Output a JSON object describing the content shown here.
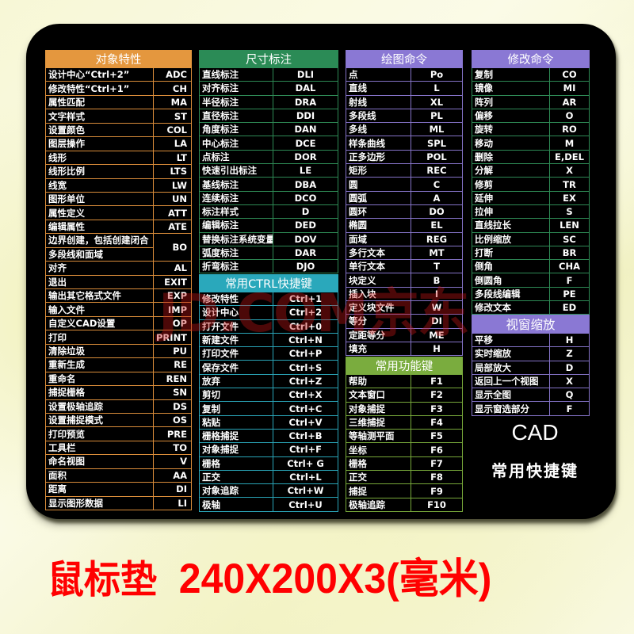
{
  "watermark": "JD.COM京东",
  "brand": {
    "title": "CAD",
    "subtitle": "常用快捷键"
  },
  "caption": {
    "product": "鼠标垫",
    "size": "240X200X3(毫米)"
  },
  "colors": {
    "pad": "#000000",
    "object_props": "#e4973e",
    "dimension": "#2b8b56",
    "ctrl": "#2aa8bb",
    "draw": "#8a78d4",
    "function": "#7aac3e",
    "modify_header": "#8a78d4",
    "caption": "#ff0000"
  },
  "tables": {
    "object_props": {
      "title": "对象特性",
      "rows": [
        [
          "设计中心“Ctrl+2”",
          "ADC"
        ],
        [
          "修改特性“Ctrl+1”",
          "CH"
        ],
        [
          "属性匹配",
          "MA"
        ],
        [
          "文字样式",
          "ST"
        ],
        [
          "设置颜色",
          "COL"
        ],
        [
          "图层操作",
          "LA"
        ],
        [
          "线形",
          "LT"
        ],
        [
          "线形比例",
          "LTS"
        ],
        [
          "线宽",
          "LW"
        ],
        [
          "图形单位",
          "UN"
        ],
        [
          "属性定义",
          "ATT"
        ],
        [
          "编辑属性",
          "ATE"
        ],
        [
          "边界创建，包括创建闭合",
          "BO"
        ],
        [
          "多段线和面域",
          ""
        ],
        [
          "对齐",
          "AL"
        ],
        [
          "退出",
          "EXIT"
        ],
        [
          "输出其它格式文件",
          "EXP"
        ],
        [
          "输入文件",
          "IMP"
        ],
        [
          "自定义CAD设置",
          "OP"
        ],
        [
          "打印",
          "PRINT"
        ],
        [
          "清除垃圾",
          "PU"
        ],
        [
          "重新生成",
          "RE"
        ],
        [
          "重命名",
          "REN"
        ],
        [
          "捕捉栅格",
          "SN"
        ],
        [
          "设置极轴追踪",
          "DS"
        ],
        [
          "设置捕捉模式",
          "OS"
        ],
        [
          "打印预览",
          "PRE"
        ],
        [
          "工具栏",
          "TO"
        ],
        [
          "命名视图",
          "V"
        ],
        [
          "面积",
          "AA"
        ],
        [
          "距离",
          "DI"
        ],
        [
          "显示图形数据",
          "LI"
        ]
      ]
    },
    "dimension": {
      "title": "尺寸标注",
      "rows": [
        [
          "直线标注",
          "DLI"
        ],
        [
          "对齐标注",
          "DAL"
        ],
        [
          "半径标注",
          "DRA"
        ],
        [
          "直径标注",
          "DDI"
        ],
        [
          "角度标注",
          "DAN"
        ],
        [
          "中心标注",
          "DCE"
        ],
        [
          "点标注",
          "DOR"
        ],
        [
          "快速引出标注",
          "LE"
        ],
        [
          "基线标注",
          "DBA"
        ],
        [
          "连续标注",
          "DCO"
        ],
        [
          "标注样式",
          "D"
        ],
        [
          "编辑标注",
          "DED"
        ],
        [
          "替换标注系统变量",
          "DOV"
        ],
        [
          "弧度标注",
          "DAR"
        ],
        [
          "折弯标注",
          "DJO"
        ]
      ]
    },
    "ctrl": {
      "title": "常用CTRL快捷键",
      "rows": [
        [
          "修改特性",
          "Ctrl+1"
        ],
        [
          "设计中心",
          "Ctrl+2"
        ],
        [
          "打开文件",
          "Ctrl+0"
        ],
        [
          "新建文件",
          "Ctrl+N"
        ],
        [
          "打印文件",
          "Ctrl+P"
        ],
        [
          "保存文件",
          "Ctrl+S"
        ],
        [
          "放弃",
          "Ctrl+Z"
        ],
        [
          "剪切",
          "Ctrl+X"
        ],
        [
          "复制",
          "Ctrl+C"
        ],
        [
          "粘贴",
          "Ctrl+V"
        ],
        [
          "栅格捕捉",
          "Ctrl+B"
        ],
        [
          "对象捕捉",
          "Ctrl+F"
        ],
        [
          "栅格",
          "Ctrl+ G"
        ],
        [
          "正交",
          "Ctrl+L"
        ],
        [
          "对象追踪",
          "Ctrl+W"
        ],
        [
          "极轴",
          "Ctrl+U"
        ]
      ]
    },
    "draw": {
      "title": "绘图命令",
      "rows": [
        [
          "点",
          "Po"
        ],
        [
          "直线",
          "L"
        ],
        [
          "射线",
          "XL"
        ],
        [
          "多段线",
          "PL"
        ],
        [
          "多线",
          "ML"
        ],
        [
          "样条曲线",
          "SPL"
        ],
        [
          "正多边形",
          "POL"
        ],
        [
          "矩形",
          "REC"
        ],
        [
          "圆",
          "C"
        ],
        [
          "圆弧",
          "A"
        ],
        [
          "圆环",
          "DO"
        ],
        [
          "椭圆",
          "EL"
        ],
        [
          "面域",
          "REG"
        ],
        [
          "多行文本",
          "MT"
        ],
        [
          "单行文本",
          "T"
        ],
        [
          "块定义",
          "B"
        ],
        [
          "插入块",
          "I"
        ],
        [
          "定义块文件",
          "W"
        ],
        [
          "等分",
          "DI"
        ],
        [
          "定距等分",
          "ME"
        ],
        [
          "填充",
          "H"
        ]
      ]
    },
    "function": {
      "title": "常用功能键",
      "rows": [
        [
          "帮助",
          "F1"
        ],
        [
          "文本窗口",
          "F2"
        ],
        [
          "对象捕捉",
          "F3"
        ],
        [
          "三维捕捉",
          "F4"
        ],
        [
          "等轴测平面",
          "F5"
        ],
        [
          "坐标",
          "F6"
        ],
        [
          "栅格",
          "F7"
        ],
        [
          "正交",
          "F8"
        ],
        [
          "捕捉",
          "F9"
        ],
        [
          "极轴追踪",
          "F10"
        ]
      ]
    },
    "modify": {
      "title": "修改命令",
      "rows": [
        [
          "复制",
          "CO"
        ],
        [
          "镜像",
          "MI"
        ],
        [
          "阵列",
          "AR"
        ],
        [
          "偏移",
          "O"
        ],
        [
          "旋转",
          "RO"
        ],
        [
          "移动",
          "M"
        ],
        [
          "删除",
          "E,DEL"
        ],
        [
          "分解",
          "X"
        ],
        [
          "修剪",
          "TR"
        ],
        [
          "延伸",
          "EX"
        ],
        [
          "拉伸",
          "S"
        ],
        [
          "直线拉长",
          "LEN"
        ],
        [
          "比例缩放",
          "SC"
        ],
        [
          "打断",
          "BR"
        ],
        [
          "倒角",
          "CHA"
        ],
        [
          "倒圆角",
          "F"
        ],
        [
          "多段线编辑",
          "PE"
        ],
        [
          "修改文本",
          "ED"
        ]
      ]
    },
    "view": {
      "title": "视窗缩放",
      "rows": [
        [
          "平移",
          "H"
        ],
        [
          "实时缩放",
          "Z"
        ],
        [
          "局部放大",
          "D"
        ],
        [
          "返回上一个视图",
          "X"
        ],
        [
          "显示全图",
          "Q"
        ],
        [
          "显示窗选部分",
          "F"
        ]
      ]
    }
  }
}
